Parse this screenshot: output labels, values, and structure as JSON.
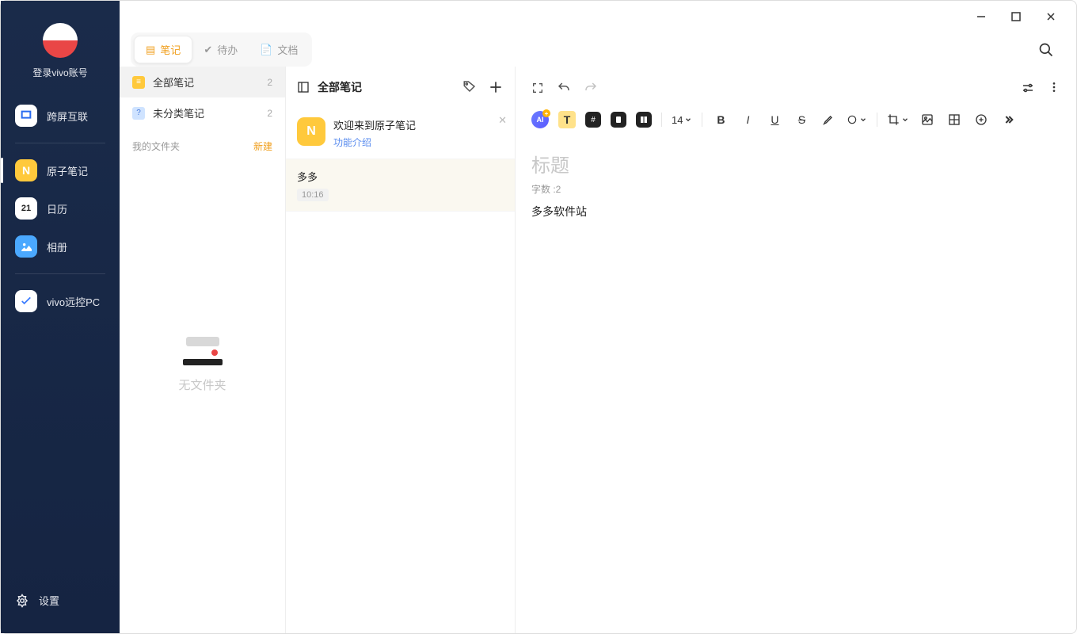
{
  "sidebar": {
    "login_label": "登录vivo账号",
    "items": [
      {
        "label": "跨屏互联",
        "icon": "link"
      },
      {
        "label": "原子笔记",
        "icon": "note",
        "active": true
      },
      {
        "label": "日历",
        "icon": "calendar",
        "badge": "21"
      },
      {
        "label": "相册",
        "icon": "photo"
      },
      {
        "label": "vivo远控PC",
        "icon": "remote"
      }
    ],
    "settings_label": "设置"
  },
  "tabs": {
    "notes": "笔记",
    "todo": "待办",
    "docs": "文档"
  },
  "folders": {
    "all": {
      "label": "全部笔记",
      "count": "2"
    },
    "uncat": {
      "label": "未分类笔记",
      "count": "2"
    },
    "section_label": "我的文件夹",
    "new_label": "新建",
    "empty_label": "无文件夹"
  },
  "notelist": {
    "header": "全部笔记",
    "items": [
      {
        "title": "欢迎来到原子笔记",
        "subtitle": "功能介绍",
        "thumb": "N",
        "closable": true
      },
      {
        "title": "多多",
        "time": "10:16",
        "selected": true
      }
    ]
  },
  "editor": {
    "font_size": "14",
    "title_placeholder": "标题",
    "word_count_label": "字数 :2",
    "body": "多多软件站"
  }
}
